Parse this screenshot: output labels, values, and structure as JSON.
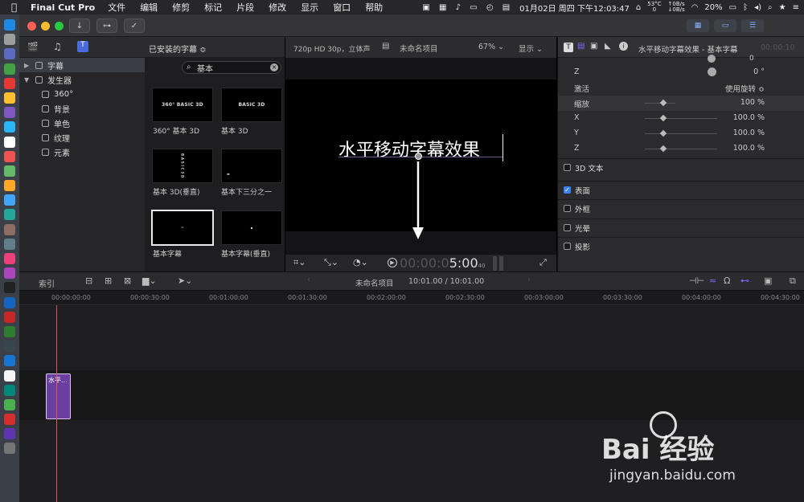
{
  "menubar": {
    "app": "Final Cut Pro",
    "items": [
      "文件",
      "编辑",
      "修剪",
      "标记",
      "片段",
      "修改",
      "显示",
      "窗口",
      "帮助"
    ],
    "status": {
      "temp": "53°C",
      "temp_sub": "0",
      "net_up": "0B/s",
      "net_down": "0B/s",
      "datetime": "01月02日 周四 下午12:03:47",
      "battery": "20%"
    }
  },
  "library": {
    "dropdown_label": "已安装的字幕 ≎",
    "search_value": "基本",
    "sidebar": [
      {
        "label": "字幕",
        "level": 0,
        "selected": true,
        "expanded": false
      },
      {
        "label": "发生器",
        "level": 0,
        "selected": false,
        "expanded": true
      },
      {
        "label": "360°",
        "level": 1
      },
      {
        "label": "背景",
        "level": 1
      },
      {
        "label": "单色",
        "level": 1
      },
      {
        "label": "纹理",
        "level": 1
      },
      {
        "label": "元素",
        "level": 1
      }
    ],
    "thumbnails": [
      {
        "label": "360° 基本 3D",
        "preview": "360° BASIC 3D"
      },
      {
        "label": "基本 3D",
        "preview": "BASIC 3D"
      },
      {
        "label": "基本 3D(垂直)",
        "preview": "B A S I C 3 D"
      },
      {
        "label": "基本下三分之一",
        "preview": "▬"
      },
      {
        "label": "基本字幕",
        "preview": "~",
        "selected": true
      },
      {
        "label": "基本字幕(垂直)",
        "preview": "▪"
      }
    ]
  },
  "viewer": {
    "format": "720p HD 30p，立体声",
    "project": "未命名项目",
    "zoom": "67%",
    "display": "显示",
    "title_text": "水平移动字幕效果",
    "timecode_dim": "00:00:0",
    "timecode": "5:00",
    "frames": "40"
  },
  "inspector": {
    "title": "水平移动字幕效果 - 基本字幕",
    "time": "00:00:10",
    "rows": [
      {
        "key": "Z",
        "value": "0 °"
      },
      {
        "key": "激活",
        "value": "使用旋转 ≎"
      },
      {
        "key": "缩放",
        "value": "100 %"
      },
      {
        "key": "X",
        "value": "100.0 %"
      },
      {
        "key": "Y",
        "value": "100.0 %"
      },
      {
        "key": "Z",
        "value": "100.0 %"
      }
    ],
    "top_value": "0",
    "sections": [
      {
        "label": "3D 文本",
        "checked": false
      },
      {
        "label": "表面",
        "checked": true
      },
      {
        "label": "外框",
        "checked": false
      },
      {
        "label": "光晕",
        "checked": false
      },
      {
        "label": "投影",
        "checked": false
      }
    ]
  },
  "timeline": {
    "index_label": "索引",
    "project": "未命名项目",
    "duration": "10:01.00 / 10:01.00",
    "ruler": [
      "00:00:00:00",
      "00:00:30:00",
      "00:01:00:00",
      "00:01:30:00",
      "00:02:00:00",
      "00:02:30:00",
      "00:03:00:00",
      "00:03:30:00",
      "00:04:00:00",
      "00:04:30:00"
    ],
    "clip_label": "水平..."
  },
  "watermark": {
    "brand": "Bai 经验",
    "url": "jingyan.baidu.com"
  },
  "colors": {
    "accent": "#7b6cff",
    "clip": "#6a3fa0",
    "playhead": "#dd5555"
  }
}
